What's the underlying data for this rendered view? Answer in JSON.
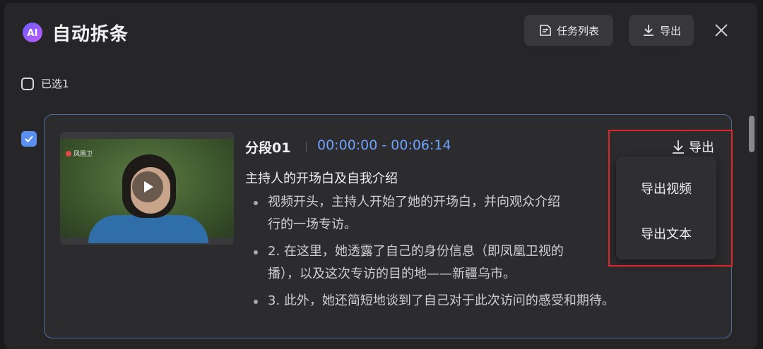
{
  "header": {
    "logo_text": "AI",
    "title": "自动拆条",
    "task_list_label": "任务列表",
    "export_label": "导出"
  },
  "selection": {
    "label": "已选1"
  },
  "segment": {
    "thumbnail_logo": "凤凰卫",
    "title": "分段01",
    "time_range": "00:00:00 - 00:06:14",
    "summary_title": "主持人的开场白及自我介绍",
    "bullets": [
      "视频开头，主持人开始了她的开场白，并向观众介绍",
      "行的一场专访。",
      "2. 在这里，她透露了自己的身份信息（即凤凰卫视的",
      "播），以及这次专访的目的地——新疆乌市。",
      "3. 此外，她还简短地谈到了自己对于此次访问的感受和期待。"
    ],
    "export_label": "导出"
  },
  "export_menu": {
    "items": [
      "导出视频",
      "导出文本"
    ]
  },
  "colors": {
    "accent": "#5a8ff0",
    "time_text": "#6ea3ff",
    "highlight_box": "#e0242a"
  }
}
